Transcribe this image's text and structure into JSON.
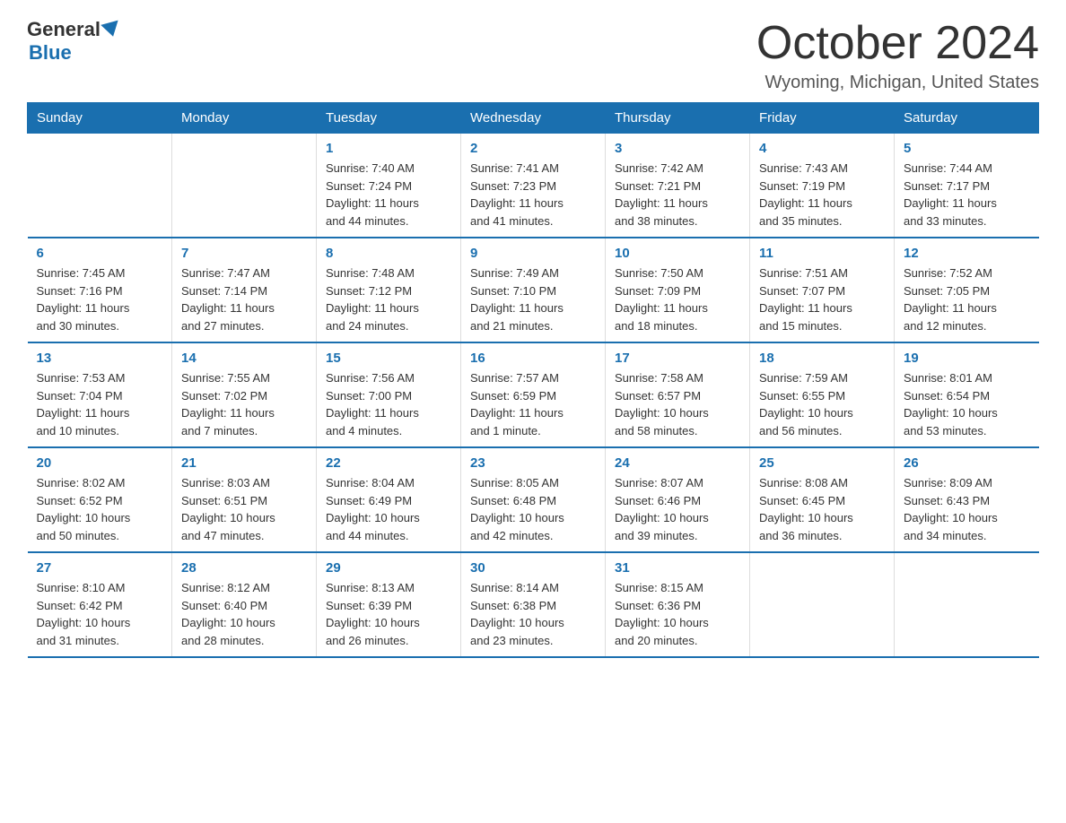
{
  "logo": {
    "general": "General",
    "blue": "Blue"
  },
  "title": "October 2024",
  "location": "Wyoming, Michigan, United States",
  "days_header": [
    "Sunday",
    "Monday",
    "Tuesday",
    "Wednesday",
    "Thursday",
    "Friday",
    "Saturday"
  ],
  "weeks": [
    [
      {
        "day": "",
        "info": ""
      },
      {
        "day": "",
        "info": ""
      },
      {
        "day": "1",
        "info": "Sunrise: 7:40 AM\nSunset: 7:24 PM\nDaylight: 11 hours\nand 44 minutes."
      },
      {
        "day": "2",
        "info": "Sunrise: 7:41 AM\nSunset: 7:23 PM\nDaylight: 11 hours\nand 41 minutes."
      },
      {
        "day": "3",
        "info": "Sunrise: 7:42 AM\nSunset: 7:21 PM\nDaylight: 11 hours\nand 38 minutes."
      },
      {
        "day": "4",
        "info": "Sunrise: 7:43 AM\nSunset: 7:19 PM\nDaylight: 11 hours\nand 35 minutes."
      },
      {
        "day": "5",
        "info": "Sunrise: 7:44 AM\nSunset: 7:17 PM\nDaylight: 11 hours\nand 33 minutes."
      }
    ],
    [
      {
        "day": "6",
        "info": "Sunrise: 7:45 AM\nSunset: 7:16 PM\nDaylight: 11 hours\nand 30 minutes."
      },
      {
        "day": "7",
        "info": "Sunrise: 7:47 AM\nSunset: 7:14 PM\nDaylight: 11 hours\nand 27 minutes."
      },
      {
        "day": "8",
        "info": "Sunrise: 7:48 AM\nSunset: 7:12 PM\nDaylight: 11 hours\nand 24 minutes."
      },
      {
        "day": "9",
        "info": "Sunrise: 7:49 AM\nSunset: 7:10 PM\nDaylight: 11 hours\nand 21 minutes."
      },
      {
        "day": "10",
        "info": "Sunrise: 7:50 AM\nSunset: 7:09 PM\nDaylight: 11 hours\nand 18 minutes."
      },
      {
        "day": "11",
        "info": "Sunrise: 7:51 AM\nSunset: 7:07 PM\nDaylight: 11 hours\nand 15 minutes."
      },
      {
        "day": "12",
        "info": "Sunrise: 7:52 AM\nSunset: 7:05 PM\nDaylight: 11 hours\nand 12 minutes."
      }
    ],
    [
      {
        "day": "13",
        "info": "Sunrise: 7:53 AM\nSunset: 7:04 PM\nDaylight: 11 hours\nand 10 minutes."
      },
      {
        "day": "14",
        "info": "Sunrise: 7:55 AM\nSunset: 7:02 PM\nDaylight: 11 hours\nand 7 minutes."
      },
      {
        "day": "15",
        "info": "Sunrise: 7:56 AM\nSunset: 7:00 PM\nDaylight: 11 hours\nand 4 minutes."
      },
      {
        "day": "16",
        "info": "Sunrise: 7:57 AM\nSunset: 6:59 PM\nDaylight: 11 hours\nand 1 minute."
      },
      {
        "day": "17",
        "info": "Sunrise: 7:58 AM\nSunset: 6:57 PM\nDaylight: 10 hours\nand 58 minutes."
      },
      {
        "day": "18",
        "info": "Sunrise: 7:59 AM\nSunset: 6:55 PM\nDaylight: 10 hours\nand 56 minutes."
      },
      {
        "day": "19",
        "info": "Sunrise: 8:01 AM\nSunset: 6:54 PM\nDaylight: 10 hours\nand 53 minutes."
      }
    ],
    [
      {
        "day": "20",
        "info": "Sunrise: 8:02 AM\nSunset: 6:52 PM\nDaylight: 10 hours\nand 50 minutes."
      },
      {
        "day": "21",
        "info": "Sunrise: 8:03 AM\nSunset: 6:51 PM\nDaylight: 10 hours\nand 47 minutes."
      },
      {
        "day": "22",
        "info": "Sunrise: 8:04 AM\nSunset: 6:49 PM\nDaylight: 10 hours\nand 44 minutes."
      },
      {
        "day": "23",
        "info": "Sunrise: 8:05 AM\nSunset: 6:48 PM\nDaylight: 10 hours\nand 42 minutes."
      },
      {
        "day": "24",
        "info": "Sunrise: 8:07 AM\nSunset: 6:46 PM\nDaylight: 10 hours\nand 39 minutes."
      },
      {
        "day": "25",
        "info": "Sunrise: 8:08 AM\nSunset: 6:45 PM\nDaylight: 10 hours\nand 36 minutes."
      },
      {
        "day": "26",
        "info": "Sunrise: 8:09 AM\nSunset: 6:43 PM\nDaylight: 10 hours\nand 34 minutes."
      }
    ],
    [
      {
        "day": "27",
        "info": "Sunrise: 8:10 AM\nSunset: 6:42 PM\nDaylight: 10 hours\nand 31 minutes."
      },
      {
        "day": "28",
        "info": "Sunrise: 8:12 AM\nSunset: 6:40 PM\nDaylight: 10 hours\nand 28 minutes."
      },
      {
        "day": "29",
        "info": "Sunrise: 8:13 AM\nSunset: 6:39 PM\nDaylight: 10 hours\nand 26 minutes."
      },
      {
        "day": "30",
        "info": "Sunrise: 8:14 AM\nSunset: 6:38 PM\nDaylight: 10 hours\nand 23 minutes."
      },
      {
        "day": "31",
        "info": "Sunrise: 8:15 AM\nSunset: 6:36 PM\nDaylight: 10 hours\nand 20 minutes."
      },
      {
        "day": "",
        "info": ""
      },
      {
        "day": "",
        "info": ""
      }
    ]
  ]
}
